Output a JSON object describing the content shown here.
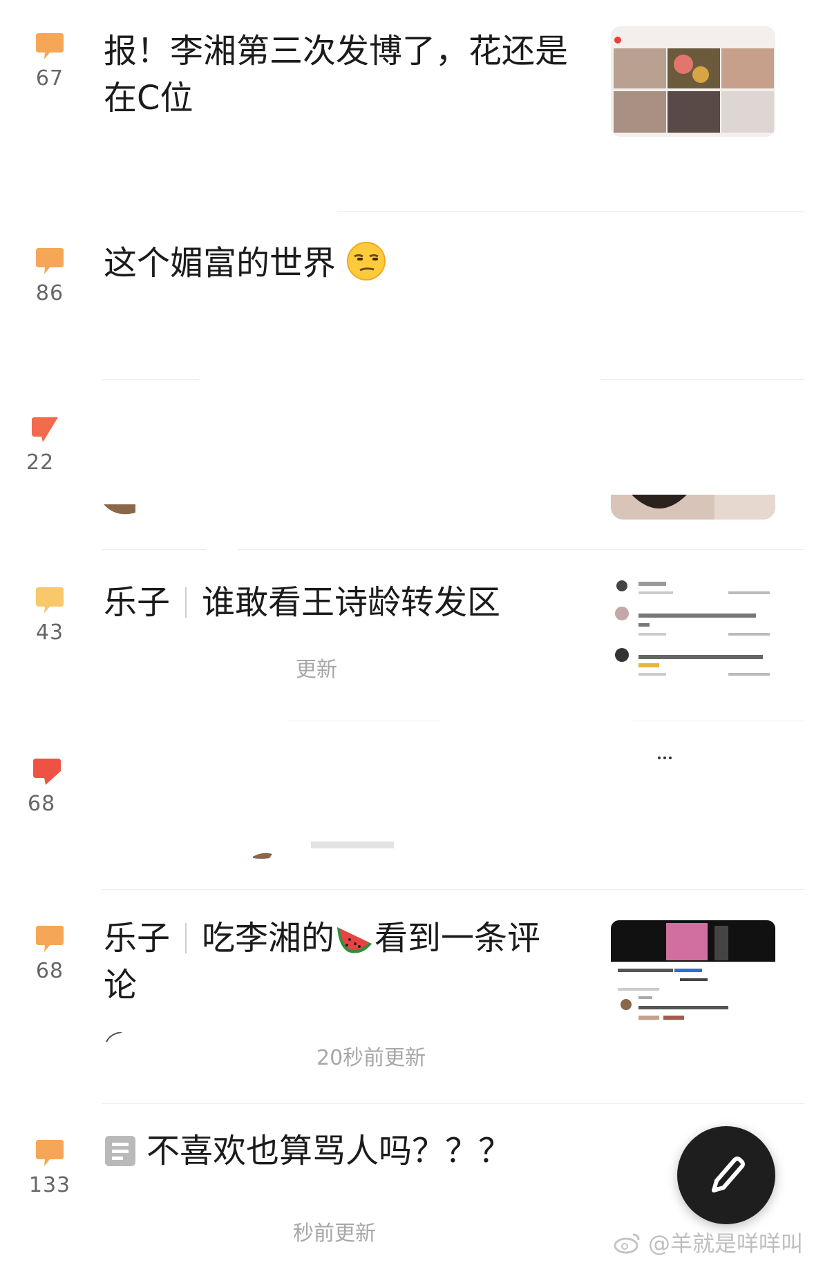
{
  "feed": {
    "items": [
      {
        "count": "67",
        "bubble_color": "#F5A656",
        "title": "报！李湘第三次发博了，花还是在C位",
        "has_thumb": true
      },
      {
        "count": "86",
        "bubble_color": "#F5A656",
        "title": "这个媚富的世界",
        "emoji": "unamused-face"
      },
      {
        "count": "22",
        "bubble_color": "#F26B4F"
      },
      {
        "count": "43",
        "bubble_color": "#F9C86A",
        "tag": "乐子",
        "title": "谁敢看王诗龄转发区",
        "meta": "更新"
      },
      {
        "count": "68",
        "bubble_color": "#EF5245"
      },
      {
        "count": "68",
        "bubble_color": "#F5A656",
        "tag": "乐子",
        "title_part1": "吃李湘的",
        "emoji": "watermelon",
        "title_part2": "看到一条评论",
        "meta": "20秒前更新"
      },
      {
        "count": "133",
        "bubble_color": "#F5A656",
        "title": "不喜欢也算骂人吗？？？",
        "meta": "秒前更新"
      }
    ]
  },
  "fab": {
    "icon": "pencil-icon"
  },
  "watermark": {
    "text": "@羊就是咩咩叫"
  }
}
